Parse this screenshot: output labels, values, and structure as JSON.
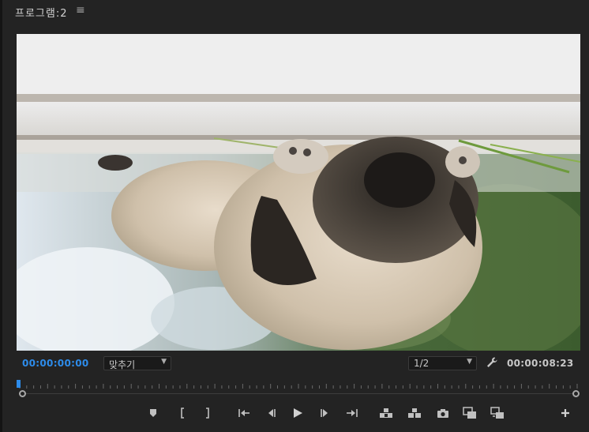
{
  "panel": {
    "title": "프로그램:2",
    "menu_icon": "hamburger-icon"
  },
  "viewer": {
    "content": "monitor-frame"
  },
  "controls": {
    "current_timecode": "00:00:00:00",
    "zoom_value": "맞추기",
    "resolution_value": "1/2",
    "duration_timecode": "00:00:08:23"
  },
  "transport_icons": [
    "add-marker-icon",
    "mark-in-icon",
    "mark-out-icon",
    "go-to-in-icon",
    "step-back-icon",
    "play-icon",
    "step-forward-icon",
    "go-to-out-icon",
    "lift-icon",
    "extract-icon",
    "export-frame-icon",
    "comparison-view-icon",
    "proxy-toggle-icon",
    "button-editor-icon"
  ],
  "colors": {
    "accent": "#2d8ceb",
    "background": "#232323"
  }
}
